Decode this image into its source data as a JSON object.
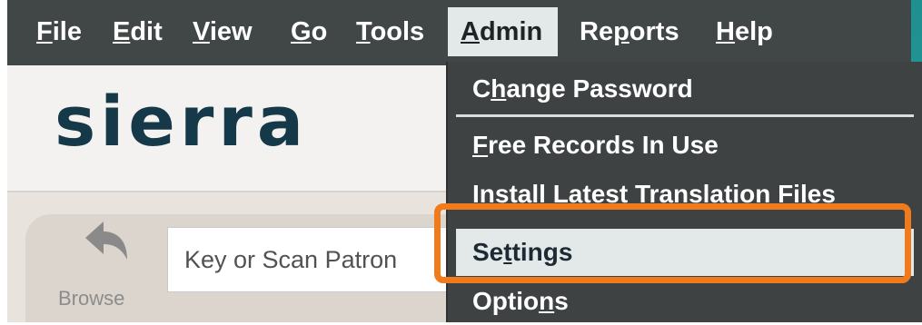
{
  "menubar": {
    "items": [
      {
        "pre": "",
        "mnem": "F",
        "post": "ile"
      },
      {
        "pre": "",
        "mnem": "E",
        "post": "dit"
      },
      {
        "pre": "",
        "mnem": "V",
        "post": "iew"
      },
      {
        "pre": "",
        "mnem": "G",
        "post": "o"
      },
      {
        "pre": "",
        "mnem": "T",
        "post": "ools"
      },
      {
        "pre": "",
        "mnem": "A",
        "post": "dmin"
      },
      {
        "pre": "Re",
        "mnem": "p",
        "post": "orts"
      },
      {
        "pre": "",
        "mnem": "H",
        "post": "elp"
      }
    ],
    "active": "Admin"
  },
  "logo": {
    "text": "sierra"
  },
  "toolbar": {
    "browse_label": "Browse",
    "browse_icon": "back-arrow-icon",
    "patron_placeholder": "Key or Scan Patron"
  },
  "admin_menu": {
    "items": [
      {
        "pre": "C",
        "mnem": "h",
        "post": "ange Password"
      },
      {
        "pre": "",
        "mnem": "F",
        "post": "ree Records In Use"
      },
      {
        "pre": "Install Latest Translation Files",
        "mnem": "",
        "post": ""
      },
      {
        "pre": "Se",
        "mnem": "t",
        "post": "tings"
      },
      {
        "pre": "Optio",
        "mnem": "n",
        "post": "s"
      }
    ],
    "selected": "Settings"
  },
  "colors": {
    "menubar_bg": "#414646",
    "active_bg": "#e3e9e9",
    "logo_color": "#16394a",
    "highlight": "#f07b1c",
    "teal_edge": "#1f8f8f"
  }
}
